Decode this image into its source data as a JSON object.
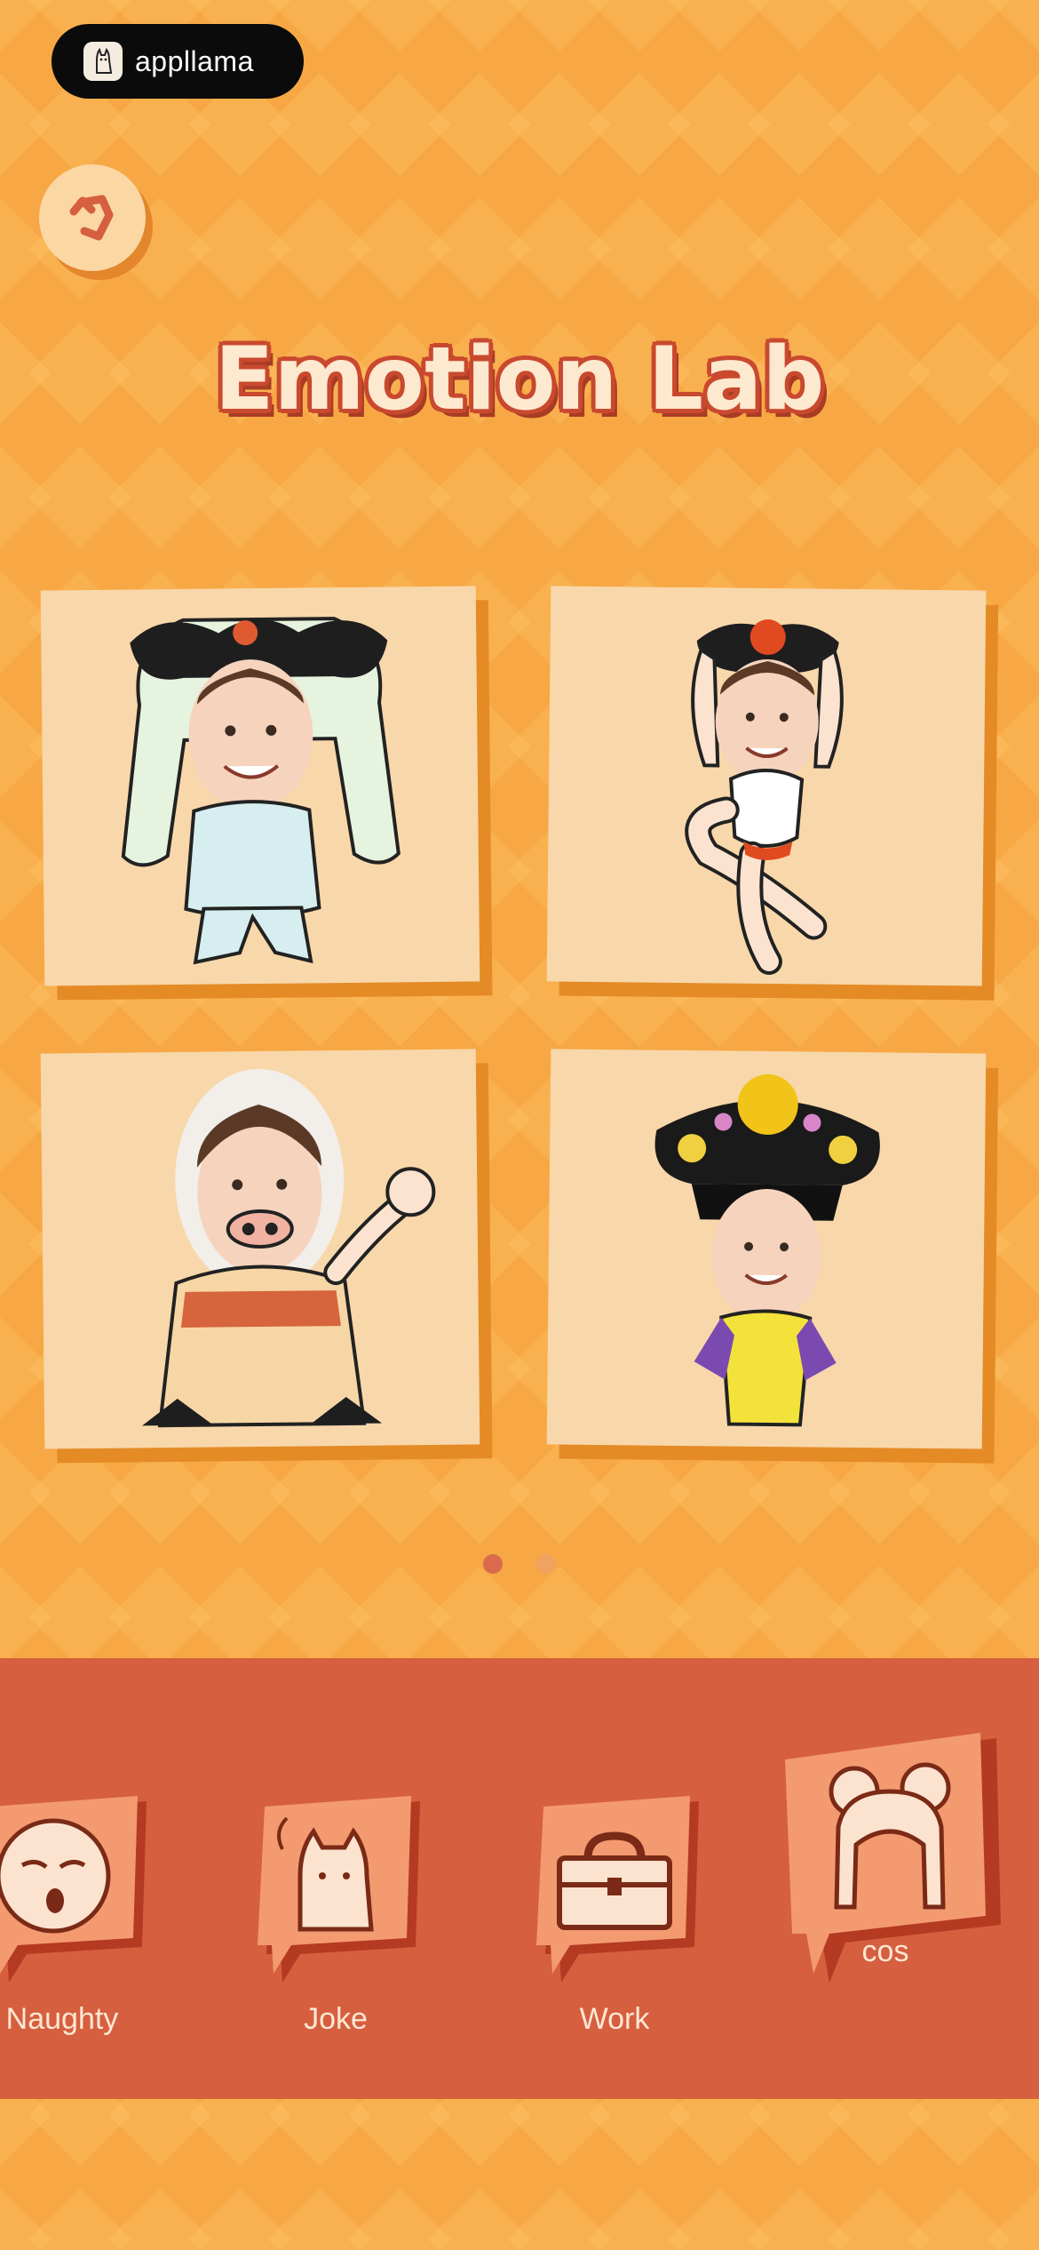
{
  "badge": {
    "name": "appllama",
    "icon": "llama-icon"
  },
  "header": {
    "back_icon": "back-arrow-icon",
    "title": "Emotion Lab"
  },
  "stickers": [
    {
      "name": "sticker-fairy-costume"
    },
    {
      "name": "sticker-dancer-costume"
    },
    {
      "name": "sticker-pig-nose-costume"
    },
    {
      "name": "sticker-qing-headdress-costume"
    }
  ],
  "pagination": {
    "total": 2,
    "active": 1
  },
  "categories": [
    {
      "label": "Naughty",
      "icon": "naughty-face-icon",
      "selected": false
    },
    {
      "label": "Joke",
      "icon": "llama-icon",
      "selected": false
    },
    {
      "label": "Work",
      "icon": "briefcase-icon",
      "selected": false
    },
    {
      "label": "cos",
      "icon": "wig-icon",
      "selected": true
    }
  ],
  "colors": {
    "background": "#f7a844",
    "bar": "#d65f3f",
    "card": "#f8d7aa",
    "title_fill": "#fde9cf",
    "title_outline": "#c9492f"
  }
}
